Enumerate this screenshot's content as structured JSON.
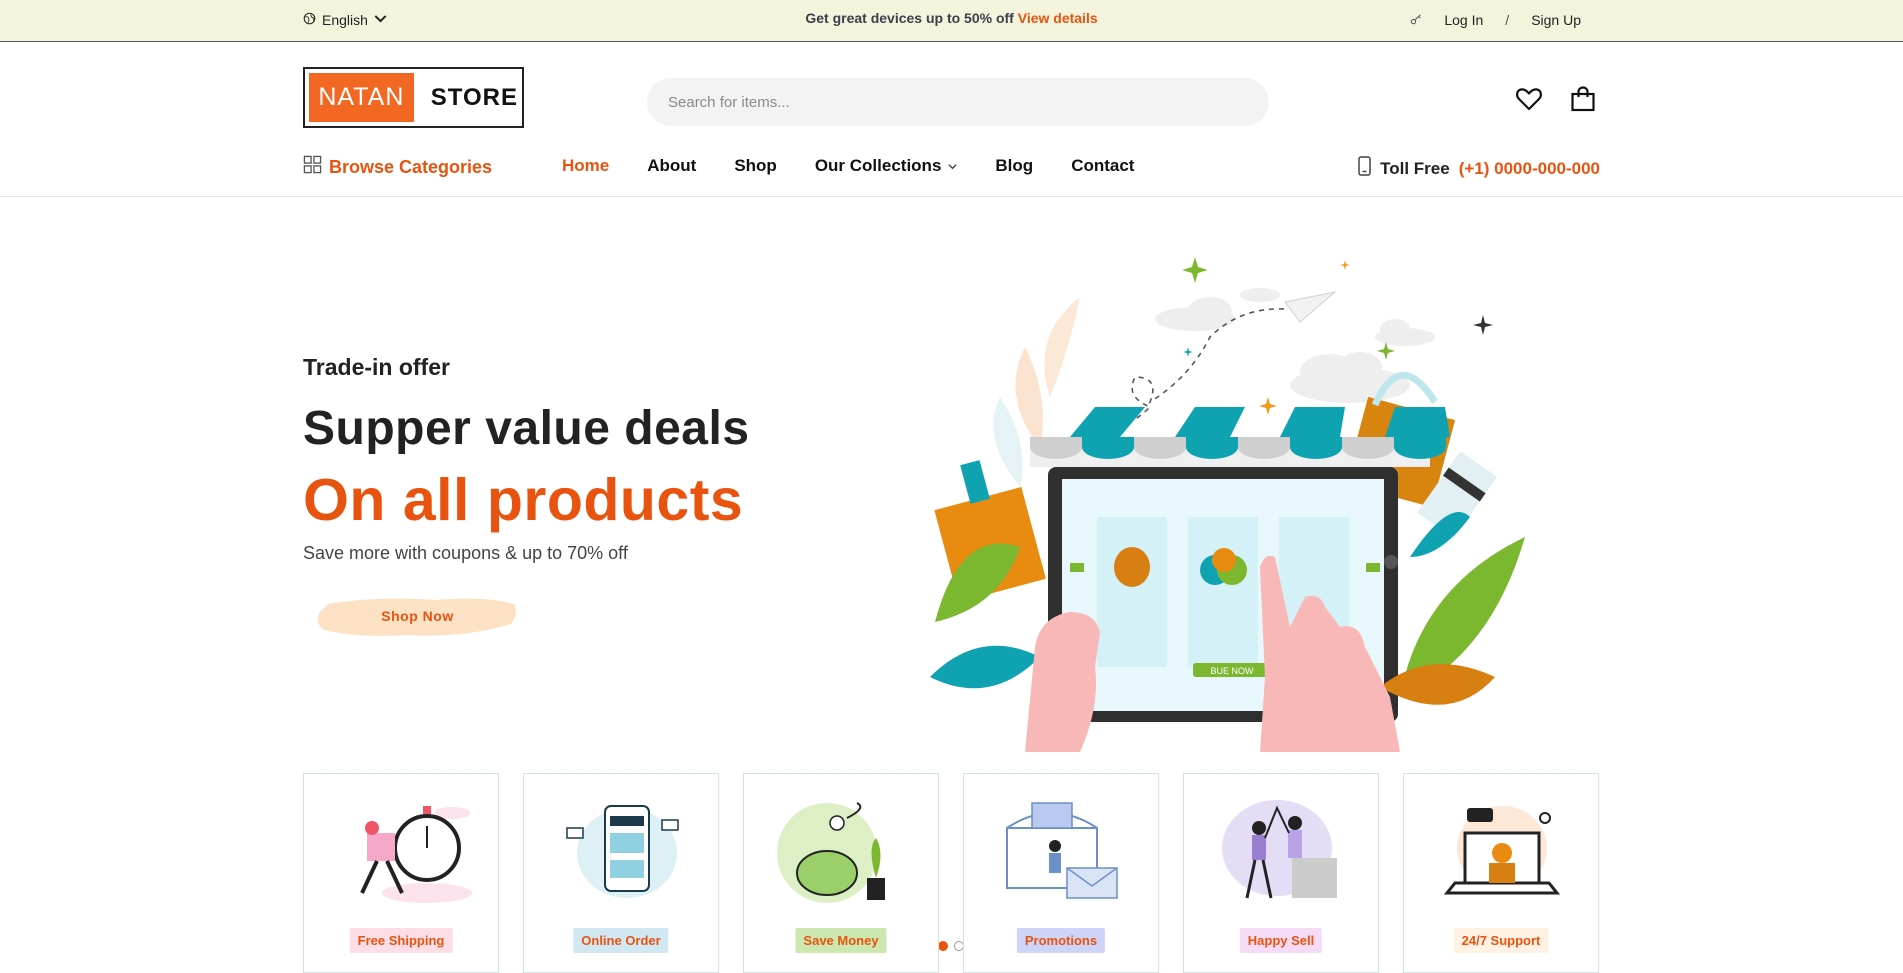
{
  "topbar": {
    "language": "English",
    "promo_text": "Get great devices up to 50% off",
    "promo_link": "View details",
    "login": "Log In",
    "separator": "/",
    "signup": "Sign Up"
  },
  "header": {
    "logo_left": "NATAN",
    "logo_right": "STORE",
    "search_placeholder": "Search for items...",
    "icons": [
      "heart-icon",
      "shopping-bag-icon"
    ]
  },
  "nav": {
    "browse_label": "Browse Categories",
    "items": [
      {
        "label": "Home",
        "active": true
      },
      {
        "label": "About"
      },
      {
        "label": "Shop"
      },
      {
        "label": "Our Collections",
        "dropdown": true
      },
      {
        "label": "Blog"
      },
      {
        "label": "Contact"
      }
    ],
    "toll_label": "Toll Free",
    "toll_number": "(+1) 0000-000-000"
  },
  "hero": {
    "eyebrow": "Trade-in offer",
    "title_line1": "Supper value deals",
    "title_line2": "On all products",
    "subtitle": "Save more with coupons & up to 70% off",
    "cta": "Shop Now",
    "illustration_button": "BUE NOW",
    "slides": 2,
    "active_slide": 1
  },
  "features": [
    {
      "label": "Free Shipping",
      "badge_color": "#fddde6"
    },
    {
      "label": "Online Order",
      "badge_color": "#d1e8f2"
    },
    {
      "label": "Save Money",
      "badge_color": "#cde7b0"
    },
    {
      "label": "Promotions",
      "badge_color": "#cdd4f8"
    },
    {
      "label": "Happy Sell",
      "badge_color": "#f6dbf6"
    },
    {
      "label": "24/7 Support",
      "badge_color": "#fff2e5"
    }
  ],
  "colors": {
    "accent": "#e8540f",
    "topbar_bg": "#f4f3dc"
  }
}
